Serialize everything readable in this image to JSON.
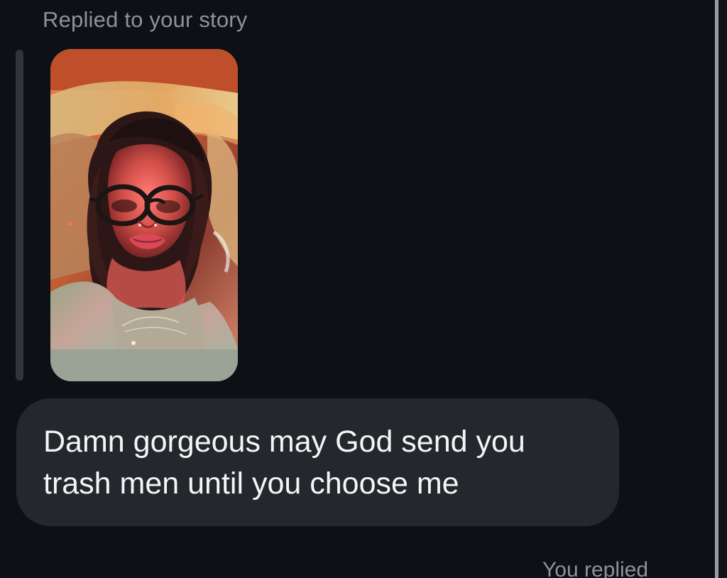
{
  "conversation": {
    "reply_caption": "Replied to your story",
    "story": {
      "icon": "story-thumbnail"
    },
    "message": {
      "text": "Damn gorgeous may God send you trash men until you choose me"
    },
    "footer": {
      "replied_label": "You replied"
    }
  },
  "colors": {
    "background": "#0d1014",
    "bubble": "#24282d",
    "text_primary": "#f4f5f6",
    "text_secondary": "#8e9399",
    "story_accent": "#bf4e2a"
  }
}
